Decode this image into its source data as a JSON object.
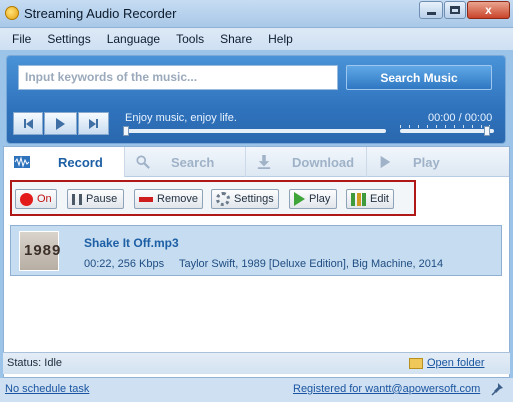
{
  "window": {
    "title": "Streaming Audio Recorder",
    "close_glyph": "x"
  },
  "menu": [
    "File",
    "Settings",
    "Language",
    "Tools",
    "Share",
    "Help"
  ],
  "search": {
    "placeholder": "Input keywords of the music...",
    "button": "Search Music"
  },
  "player": {
    "tagline": "Enjoy music, enjoy life.",
    "time": "00:00 / 00:00",
    "progress_fraction": 0.0,
    "volume_fraction": 0.95
  },
  "tabs": [
    {
      "label": "Record",
      "icon": "waveform-icon",
      "active": true
    },
    {
      "label": "Search",
      "icon": "magnifier-icon",
      "active": false
    },
    {
      "label": "Download",
      "icon": "download-arrow-icon",
      "active": false
    },
    {
      "label": "Play",
      "icon": "play-icon",
      "active": false
    }
  ],
  "toolbar": {
    "on": "On",
    "pause": "Pause",
    "remove": "Remove",
    "settings": "Settings",
    "play": "Play",
    "edit": "Edit"
  },
  "tracks": [
    {
      "title": "Shake It Off.mp3",
      "duration_bitrate": "00:22, 256 Kbps",
      "info": "Taylor Swift, 1989 [Deluxe Edition], Big Machine, 2014",
      "cover_text": "1989"
    }
  ],
  "status": {
    "text": "Status: Idle",
    "open_folder": "Open folder"
  },
  "footer": {
    "schedule": "No schedule task",
    "registered": "Registered for wantt@apowersoft.com"
  },
  "colors": {
    "accent": "#2f73bd",
    "highlight_border": "#b01818",
    "link": "#1b55a0"
  }
}
